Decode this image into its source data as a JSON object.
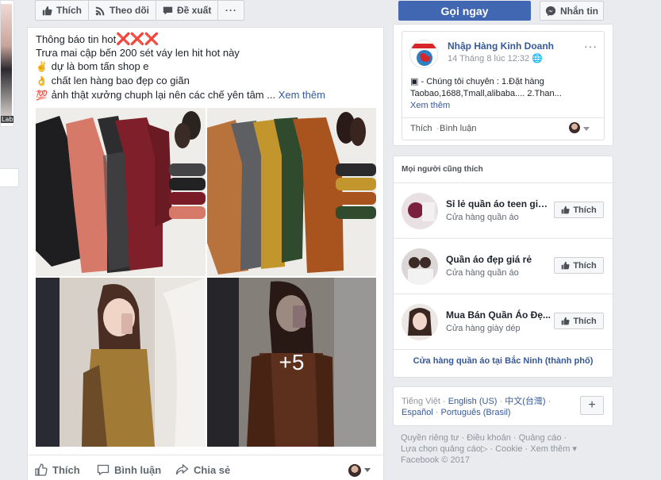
{
  "topbar": {
    "like_label": "Thích",
    "follow_label": "Theo dõi",
    "suggest_label": "Đề xuất",
    "more_label": "···",
    "call_label": "Gọi ngay",
    "message_label": "Nhắn tin"
  },
  "left_thumb": {
    "label": "Lab"
  },
  "post": {
    "line1": "Thông báo tin hot",
    "line1_marks": "❌❌❌",
    "line2": "Trưa mai cập bến 200 sét váy len hit hot này",
    "line3_emoji": "✌",
    "line3": "dự là bom tấn shop e",
    "line4_emoji": "👌",
    "line4": "chất len hàng bao đẹp co giãn",
    "line5_emoji": "💯",
    "line5": "ảnh thật xưởng chuph lại nên các chế yên tâm ...",
    "see_more": "Xem thêm",
    "extra_photos": "+5",
    "actions": {
      "like": "Thích",
      "comment": "Bình luận",
      "share": "Chia sẻ"
    }
  },
  "embed": {
    "page_name": "Nhập Hàng Kinh Doanh",
    "date": "14 Tháng 8 lúc 12:32",
    "body_line1": "- Chúng tôi chuyên : 1.Đặt hàng",
    "body_line2": "Taobao,1688,Tmall,alibaba.... 2.Than...",
    "see_more": "Xem thêm",
    "more": "···",
    "like": "Thích",
    "dot": "·",
    "comment": "Bình luận"
  },
  "likes": {
    "header": "Mọi người cũng thích",
    "items": [
      {
        "title": "Sỉ lẻ quần áo teen giá...",
        "subtitle": "Cửa hàng quần áo",
        "button": "Thích"
      },
      {
        "title": "Quần áo đẹp giá rẻ",
        "subtitle": "Cửa hàng quần áo",
        "button": "Thích"
      },
      {
        "title": "Mua Bán Quần Áo Đẹ...",
        "subtitle": "Cửa hàng giày dép",
        "button": "Thích"
      }
    ],
    "footer": "Cửa hàng quần áo tại Bắc Ninh (thành phố)"
  },
  "languages": {
    "current": "Tiếng Việt",
    "sep": " · ",
    "english": "English (US)",
    "chinese": "中文(台灣)",
    "spanish": "Español",
    "portuguese": "Português (Brasil)",
    "plus": "+"
  },
  "footer": {
    "privacy": "Quyền riêng tư",
    "terms": "Điều khoản",
    "ads": "Quảng cáo",
    "ad_choices": "Lựa chọn quảng cáo",
    "cookie": "Cookie",
    "more": "Xem thêm",
    "copyright": "Facebook © 2017"
  },
  "colors": {
    "brand": "#4267b2",
    "link": "#365899",
    "background": "#e9ebee",
    "muted": "#90949c"
  }
}
